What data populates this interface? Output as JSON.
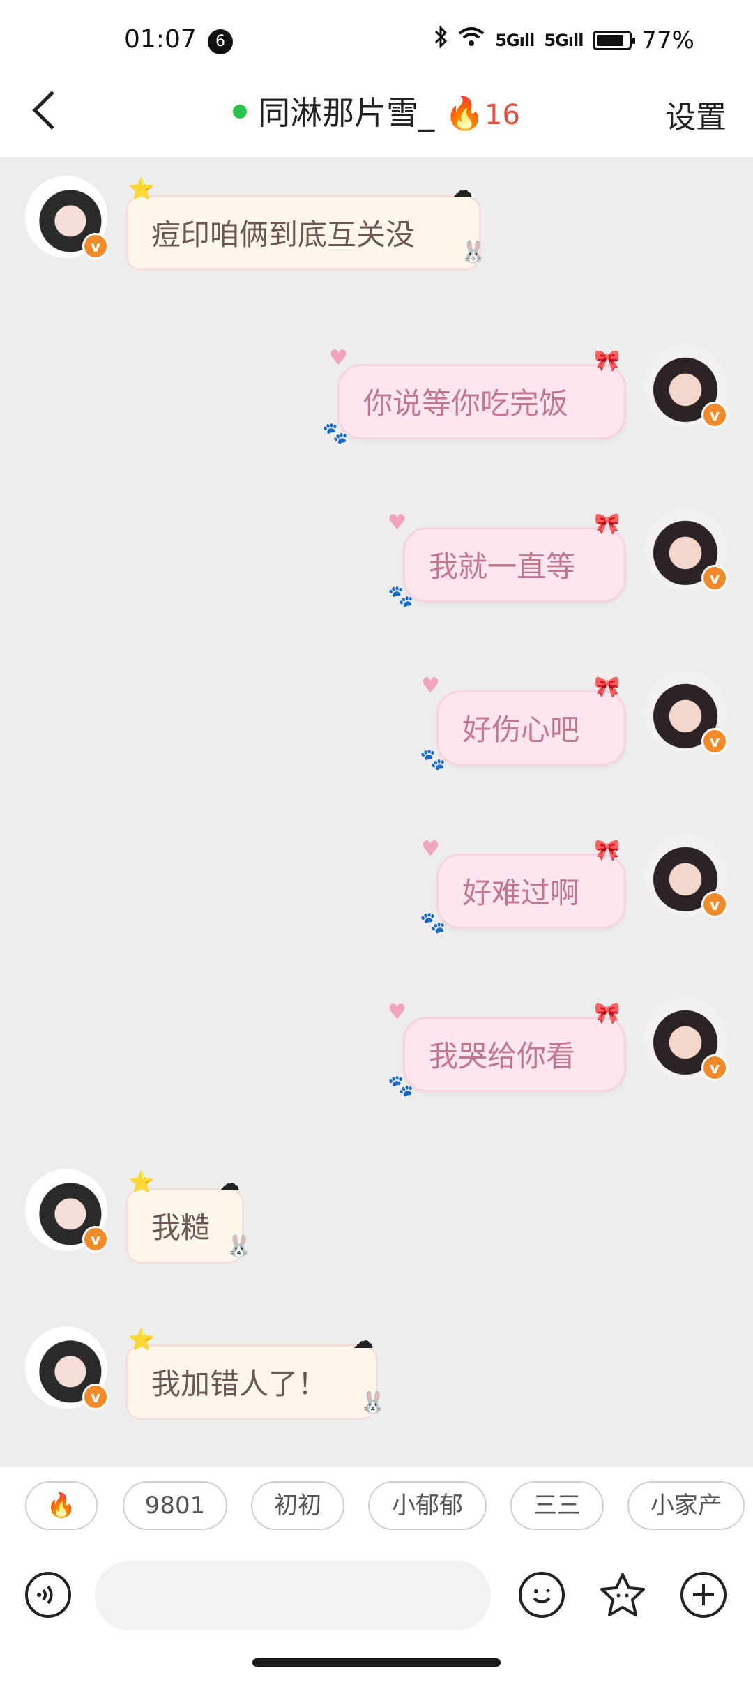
{
  "status_bar": {
    "time": "01:07",
    "notification_count": "6",
    "signal_1": "5G",
    "signal_2": "5G",
    "battery": "77%"
  },
  "header": {
    "title": "同淋那片雪_",
    "fire_count": "16",
    "settings_label": "设置",
    "online_color": "#2bc34a"
  },
  "messages": [
    {
      "side": "other",
      "text": "痘印咱俩到底互关没"
    },
    {
      "side": "me",
      "text": "你说等你吃完饭"
    },
    {
      "side": "me",
      "text": "我就一直等"
    },
    {
      "side": "me",
      "text": "好伤心吧"
    },
    {
      "side": "me",
      "text": "好难过啊"
    },
    {
      "side": "me",
      "text": "我哭给你看"
    },
    {
      "side": "other",
      "text": "我糙"
    },
    {
      "side": "other",
      "text": "我加错人了！"
    }
  ],
  "quick_chips": [
    "🔥",
    "9801",
    "初初",
    "小郁郁",
    "三三",
    "小家产"
  ],
  "input": {
    "placeholder": ""
  },
  "colors": {
    "bubble_other": "#fff8ea",
    "bubble_me": "#fde6ef",
    "text_me": "#c1778f",
    "badge": "#f08a2a"
  }
}
